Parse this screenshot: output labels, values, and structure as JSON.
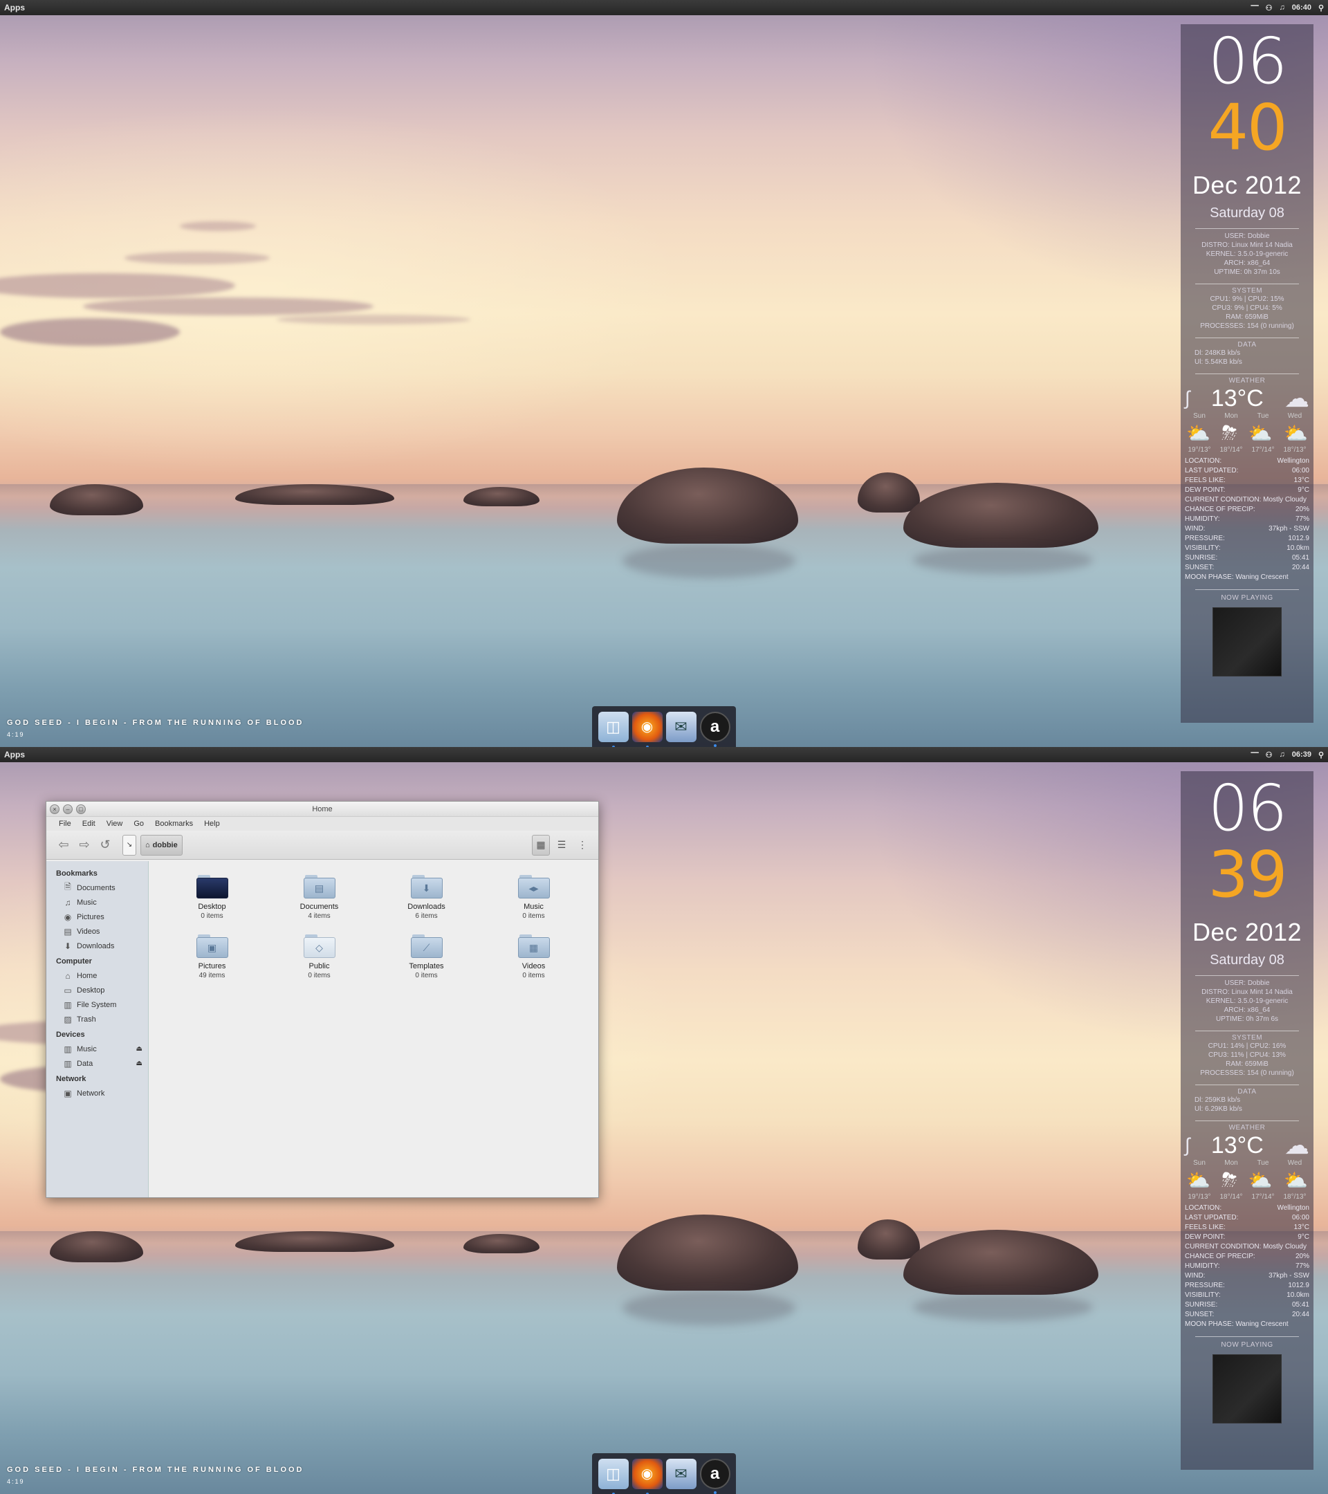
{
  "colors": {
    "clock_minutes": "#f5a623",
    "dock_indicator": "#3b8be8",
    "topbar": "#2f2f2f"
  },
  "screens": [
    {
      "topbar": {
        "apps_label": "Apps",
        "time": "06:40"
      },
      "conky": {
        "hours": "06",
        "minutes": "40",
        "month_year": "Dec 2012",
        "weekday": "Saturday 08",
        "user": [
          "USER: Dobbie",
          "DISTRO: Linux Mint 14 Nadia",
          "KERNEL: 3.5.0-19-generic",
          "ARCH: x86_64",
          "UPTIME: 0h 37m 10s"
        ],
        "system_header": "SYSTEM",
        "system": [
          "CPU1: 9% | CPU2: 15%",
          "CPU3: 9% | CPU4: 5%",
          "RAM: 659MiB",
          "PROCESSES: 154 (0 running)"
        ],
        "data_header": "DATA",
        "data": [
          "Dl: 248KB kb/s",
          "Ul: 5.54KB kb/s"
        ],
        "weather_header": "WEATHER",
        "temperature": "13°C",
        "forecast_days": [
          "Sun",
          "Mon",
          "Tue",
          "Wed"
        ],
        "forecast_temps": [
          "19°/13°",
          "18°/14°",
          "17°/14°",
          "18°/13°"
        ],
        "details": [
          [
            "LOCATION:",
            "Wellington"
          ],
          [
            "LAST UPDATED:",
            "06:00"
          ],
          [
            "FEELS LIKE:",
            "13°C"
          ],
          [
            "DEW POINT:",
            "9°C"
          ],
          [
            "CURRENT CONDITION: Mostly Cloudy",
            ""
          ],
          [
            "CHANCE OF PRECIP:",
            "20%"
          ],
          [
            "HUMIDITY:",
            "77%"
          ],
          [
            "WIND:",
            "37kph - SSW"
          ],
          [
            "PRESSURE:",
            "1012.9"
          ],
          [
            "VISIBILITY:",
            "10.0km"
          ],
          [
            "SUNRISE:",
            "05:41"
          ],
          [
            "SUNSET:",
            "20:44"
          ],
          [
            "MOON PHASE: Waning Crescent",
            ""
          ]
        ],
        "now_playing_header": "NOW PLAYING"
      },
      "song": "GOD SEED - I BEGIN - FROM THE RUNNING OF BLOOD",
      "song_time": "4:19"
    },
    {
      "topbar": {
        "apps_label": "Apps",
        "time": "06:39"
      },
      "conky": {
        "hours": "06",
        "minutes": "39",
        "month_year": "Dec 2012",
        "weekday": "Saturday 08",
        "user": [
          "USER: Dobbie",
          "DISTRO: Linux Mint 14 Nadia",
          "KERNEL: 3.5.0-19-generic",
          "ARCH: x86_64",
          "UPTIME: 0h 37m 6s"
        ],
        "system_header": "SYSTEM",
        "system": [
          "CPU1: 14% | CPU2: 16%",
          "CPU3: 11% | CPU4: 13%",
          "RAM: 659MiB",
          "PROCESSES: 154 (0 running)"
        ],
        "data_header": "DATA",
        "data": [
          "Dl: 259KB kb/s",
          "Ul: 6.29KB kb/s"
        ],
        "weather_header": "WEATHER",
        "temperature": "13°C",
        "forecast_days": [
          "Sun",
          "Mon",
          "Tue",
          "Wed"
        ],
        "forecast_temps": [
          "19°/13°",
          "18°/14°",
          "17°/14°",
          "18°/13°"
        ],
        "details": [
          [
            "LOCATION:",
            "Wellington"
          ],
          [
            "LAST UPDATED:",
            "06:00"
          ],
          [
            "FEELS LIKE:",
            "13°C"
          ],
          [
            "DEW POINT:",
            "9°C"
          ],
          [
            "CURRENT CONDITION: Mostly Cloudy",
            ""
          ],
          [
            "CHANCE OF PRECIP:",
            "20%"
          ],
          [
            "HUMIDITY:",
            "77%"
          ],
          [
            "WIND:",
            "37kph - SSW"
          ],
          [
            "PRESSURE:",
            "1012.9"
          ],
          [
            "VISIBILITY:",
            "10.0km"
          ],
          [
            "SUNRISE:",
            "05:41"
          ],
          [
            "SUNSET:",
            "20:44"
          ],
          [
            "MOON PHASE: Waning Crescent",
            ""
          ]
        ],
        "now_playing_header": "NOW PLAYING"
      },
      "song": "GOD SEED - I BEGIN - FROM THE RUNNING OF BLOOD",
      "song_time": "4:19"
    }
  ],
  "file_manager": {
    "title": "Home",
    "menu": [
      "File",
      "Edit",
      "View",
      "Go",
      "Bookmarks",
      "Help"
    ],
    "breadcrumb": "dobbie",
    "sidebar": [
      {
        "group": "Bookmarks",
        "items": [
          {
            "label": "Documents",
            "icon": "doc-icon"
          },
          {
            "label": "Music",
            "icon": "music-icon"
          },
          {
            "label": "Pictures",
            "icon": "camera-icon"
          },
          {
            "label": "Videos",
            "icon": "film-icon"
          },
          {
            "label": "Downloads",
            "icon": "download-icon"
          }
        ]
      },
      {
        "group": "Computer",
        "items": [
          {
            "label": "Home",
            "icon": "home-icon"
          },
          {
            "label": "Desktop",
            "icon": "desktop-icon"
          },
          {
            "label": "File System",
            "icon": "drive-icon"
          },
          {
            "label": "Trash",
            "icon": "trash-icon"
          }
        ]
      },
      {
        "group": "Devices",
        "items": [
          {
            "label": "Music",
            "icon": "drive-icon",
            "eject": true
          },
          {
            "label": "Data",
            "icon": "drive-icon",
            "eject": true
          }
        ]
      },
      {
        "group": "Network",
        "items": [
          {
            "label": "Network",
            "icon": "network-icon"
          }
        ]
      }
    ],
    "files": [
      {
        "name": "Desktop",
        "count": "0 items",
        "icon": "desktop-folder-icon"
      },
      {
        "name": "Documents",
        "count": "4 items",
        "icon": "documents-folder-icon"
      },
      {
        "name": "Downloads",
        "count": "6 items",
        "icon": "downloads-folder-icon"
      },
      {
        "name": "Music",
        "count": "0 items",
        "icon": "music-folder-icon"
      },
      {
        "name": "Pictures",
        "count": "49 items",
        "icon": "pictures-folder-icon"
      },
      {
        "name": "Public",
        "count": "0 items",
        "icon": "public-folder-icon"
      },
      {
        "name": "Templates",
        "count": "0 items",
        "icon": "templates-folder-icon"
      },
      {
        "name": "Videos",
        "count": "0 items",
        "icon": "videos-folder-icon"
      }
    ]
  }
}
